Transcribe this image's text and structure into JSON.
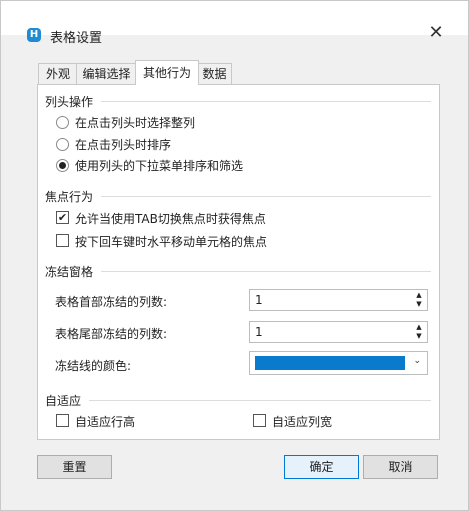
{
  "window": {
    "title": "表格设置",
    "app_icon_letter": "H",
    "close_glyph": "✕"
  },
  "tabs": [
    {
      "label": "外观",
      "active": false
    },
    {
      "label": "编辑选择",
      "active": false
    },
    {
      "label": "其他行为",
      "active": true
    },
    {
      "label": "数据",
      "active": false
    }
  ],
  "column_header": {
    "title": "列头操作",
    "options": [
      {
        "label": "在点击列头时选择整列",
        "selected": false
      },
      {
        "label": "在点击列头时排序",
        "selected": false
      },
      {
        "label": "使用列头的下拉菜单排序和筛选",
        "selected": true
      }
    ]
  },
  "focus": {
    "title": "焦点行为",
    "options": [
      {
        "label": "允许当使用TAB切换焦点时获得焦点",
        "checked": true
      },
      {
        "label": "按下回车键时水平移动单元格的焦点",
        "checked": false
      }
    ]
  },
  "freeze": {
    "title": "冻结窗格",
    "frozen_leading_label": "表格首部冻结的列数:",
    "frozen_leading_value": "1",
    "frozen_trailing_label": "表格尾部冻结的列数:",
    "frozen_trailing_value": "1",
    "line_color_label": "冻结线的颜色:",
    "line_color": "#0a7bcc"
  },
  "auto_fit": {
    "title": "自适应",
    "row_height_label": "自适应行高",
    "row_height_checked": false,
    "col_width_label": "自适应列宽",
    "col_width_checked": false
  },
  "buttons": {
    "reset": "重置",
    "ok": "确定",
    "cancel": "取消"
  },
  "colors": {
    "accent": "#0078d7",
    "swatch": "#0a7bcc"
  }
}
